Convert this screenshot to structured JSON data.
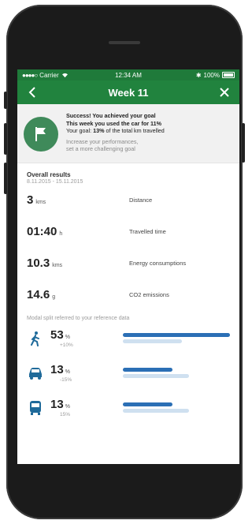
{
  "status_bar": {
    "carrier": "Carrier",
    "time": "12:34 AM",
    "battery": "100%"
  },
  "nav": {
    "title": "Week 11"
  },
  "hero": {
    "line1": "Success! You achieved your goal",
    "line2": "This week you used the car for 11%",
    "line3_prefix": "Your goal:",
    "line3_value": "13%",
    "line3_suffix": "of the total km travelled",
    "hint1": "Increase your performances,",
    "hint2": "set a more challenging goal"
  },
  "overall": {
    "title": "Overall results",
    "dates": "8.11.2015 - 15.11.2015",
    "metrics": [
      {
        "value": "3",
        "unit": "kms",
        "label": "Distance"
      },
      {
        "value": "01:40",
        "unit": "h",
        "label": "Travelled time"
      },
      {
        "value": "10.3",
        "unit": "kms",
        "label": "Energy consumptions"
      },
      {
        "value": "14.6",
        "unit": "g",
        "label": "CO2 emissions"
      }
    ]
  },
  "modal_split": {
    "title": "Modal split referred to your reference data",
    "rows": [
      {
        "icon": "walking-icon",
        "value": "53",
        "unit": "%",
        "change": "+10%",
        "current": 1.0,
        "reference": 0.55
      },
      {
        "icon": "car-icon",
        "value": "13",
        "unit": "%",
        "change": "-15%",
        "current": 0.46,
        "reference": 0.62
      },
      {
        "icon": "bus-icon",
        "value": "13",
        "unit": "%",
        "change": "15%",
        "current": 0.46,
        "reference": 0.62
      }
    ]
  },
  "colors": {
    "header_green": "#21833e",
    "status_green": "#1f7a3a",
    "flag_green": "#3f8a5a",
    "bar_blue": "#2b6fb5",
    "bar_light": "#cfe0f0"
  }
}
